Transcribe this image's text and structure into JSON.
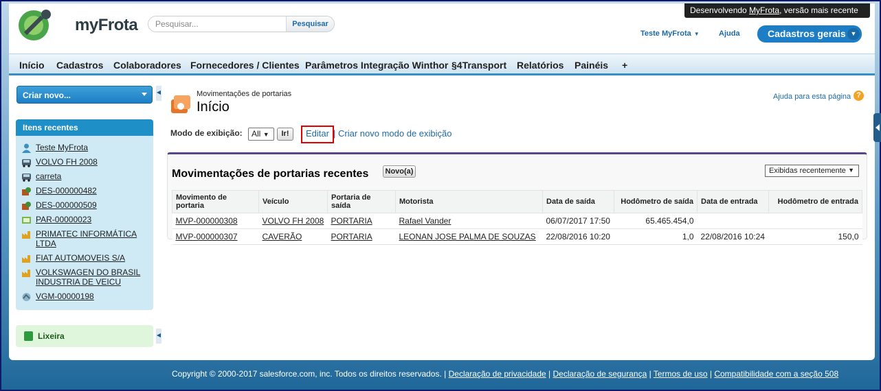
{
  "header": {
    "logo_text": "myFrota",
    "search_placeholder": "Pesquisar...",
    "search_button": "Pesquisar",
    "dev_banner_prefix": "Desenvolvendo ",
    "dev_banner_link": "MyFrota",
    "dev_banner_suffix": ", versão mais recente",
    "user_name": "Teste MyFrota",
    "help": "Ajuda",
    "app_menu": "Cadastros gerais"
  },
  "tabs": [
    "Início",
    "Cadastros",
    "Colaboradores",
    "Fornecedores / Clientes",
    "Parâmetros Integração Winthor",
    "§4Transport",
    "Relatórios",
    "Painéis",
    "+"
  ],
  "sidebar": {
    "create_new": "Criar novo...",
    "recent_title": "Itens recentes",
    "recent_items": [
      {
        "label": "Teste MyFrota",
        "icon": "user-icon"
      },
      {
        "label": "VOLVO FH 2008",
        "icon": "truck-icon"
      },
      {
        "label": "carreta",
        "icon": "truck-icon"
      },
      {
        "label": "DES-000000482",
        "icon": "expense-icon"
      },
      {
        "label": "DES-000000509",
        "icon": "expense-icon"
      },
      {
        "label": "PAR-00000023",
        "icon": "parameter-icon"
      },
      {
        "label": "PRIMATEC INFORMÁTICA LTDA",
        "icon": "factory-icon"
      },
      {
        "label": "FIAT AUTOMOVEIS S/A",
        "icon": "factory-icon"
      },
      {
        "label": "VOLKSWAGEN DO BRASIL INDUSTRIA DE VEICU",
        "icon": "factory-icon"
      },
      {
        "label": "VGM-00000198",
        "icon": "trip-icon"
      }
    ],
    "trash": "Lixeira"
  },
  "main": {
    "breadcrumb": "Movimentações de portarias",
    "title": "Início",
    "help_page": "Ajuda para esta página",
    "view_label": "Modo de exibição:",
    "view_value": "All",
    "view_go": "Ir!",
    "edit": "Editar",
    "create_view": "Criar novo modo de exibição",
    "panel_title": "Movimentações de portarias recentes",
    "new_button": "Novo(a)",
    "sort_value": "Exibidas recentemente",
    "columns": [
      "Movimento de portaria",
      "Veículo",
      "Portaria de saída",
      "Motorista",
      "Data de saída",
      "Hodômetro de saída",
      "Data de entrada",
      "Hodômetro de entrada"
    ],
    "rows": [
      [
        "MVP-000000308",
        "VOLVO FH 2008",
        "PORTARIA",
        "Rafael Vander",
        "06/07/2017 17:50",
        "65.465.454,0",
        "",
        ""
      ],
      [
        "MVP-000000307",
        "CAVERÃO",
        "PORTARIA",
        "LEONAN JOSE PALMA DE SOUZAS",
        "22/08/2016 10:20",
        "1,0",
        "22/08/2016 10:24",
        "150,0"
      ]
    ]
  },
  "footer": {
    "copyright": "Copyright © 2000-2017 salesforce.com, inc. Todos os direitos reservados. | ",
    "links": [
      "Declaração de privacidade",
      "Declaração de segurança",
      "Termos de uso",
      "Compatibilidade com a seção 508"
    ]
  },
  "colors": {
    "accent": "#1d7ec6",
    "tab_border": "#3a8ec6",
    "panel_border": "#56458c",
    "highlight_box": "#e00000"
  }
}
